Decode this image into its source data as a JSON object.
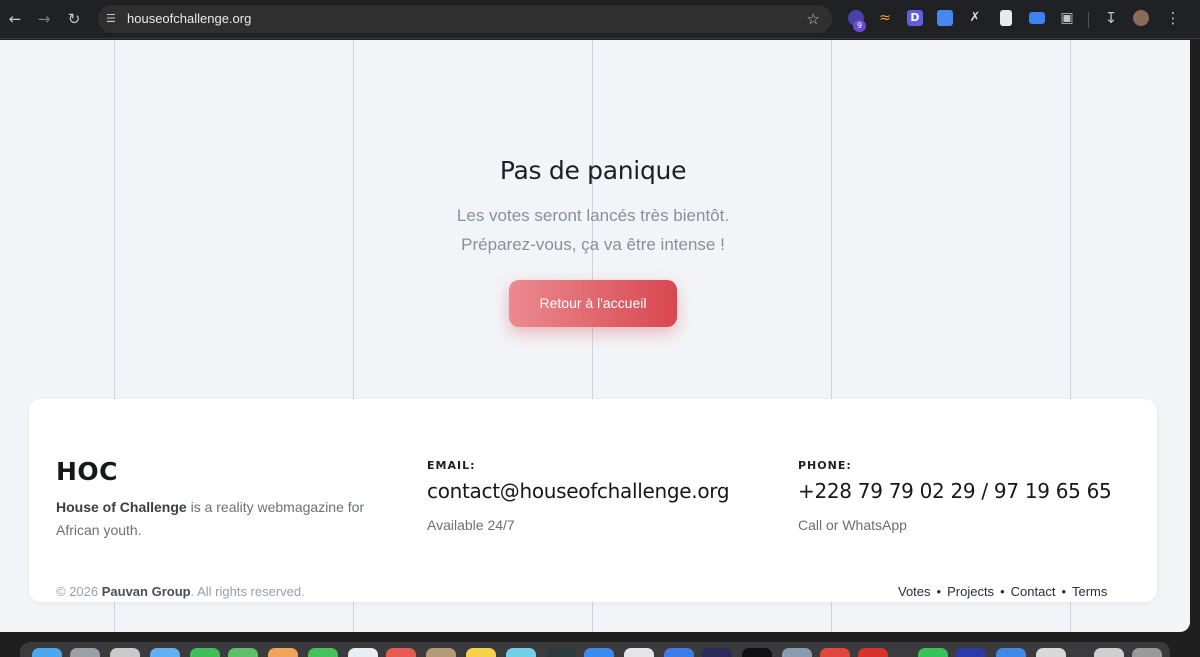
{
  "browser": {
    "url": "houseofchallenge.org",
    "extension_badge": "9"
  },
  "hero": {
    "title": "Pas de panique",
    "line1": "Les votes seront lancés très bientôt.",
    "line2": "Préparez-vous, ça va être intense !",
    "cta_label": "Retour à l'accueil"
  },
  "footer": {
    "brand": "HOC",
    "brand_name": "House of Challenge",
    "brand_desc": " is a reality webmagazine for African youth.",
    "email_label": "EMAIL:",
    "email_value": "contact@houseofchallenge.org",
    "email_note": "Available 24/7",
    "phone_label": "PHONE:",
    "phone_value": "+228 79 79 02 29 / 97 19 65 65",
    "phone_note": "Call or WhatsApp"
  },
  "bottom": {
    "copyright_prefix": "© 2026 ",
    "company": "Pauvan Group",
    "rights": ". All rights reserved.",
    "links": [
      "Votes",
      "Projects",
      "Contact",
      "Terms"
    ]
  },
  "colors": {
    "accent_start": "#eb8a90",
    "accent_end": "#d8474f",
    "page_bg": "#f2f4f7"
  },
  "icons": [
    "back-arrow-icon",
    "forward-arrow-icon",
    "reload-icon",
    "site-settings-icon",
    "bookmark-star-icon",
    "extensions-puzzle-icon",
    "download-icon",
    "profile-avatar-icon",
    "menu-kebab-icon"
  ]
}
